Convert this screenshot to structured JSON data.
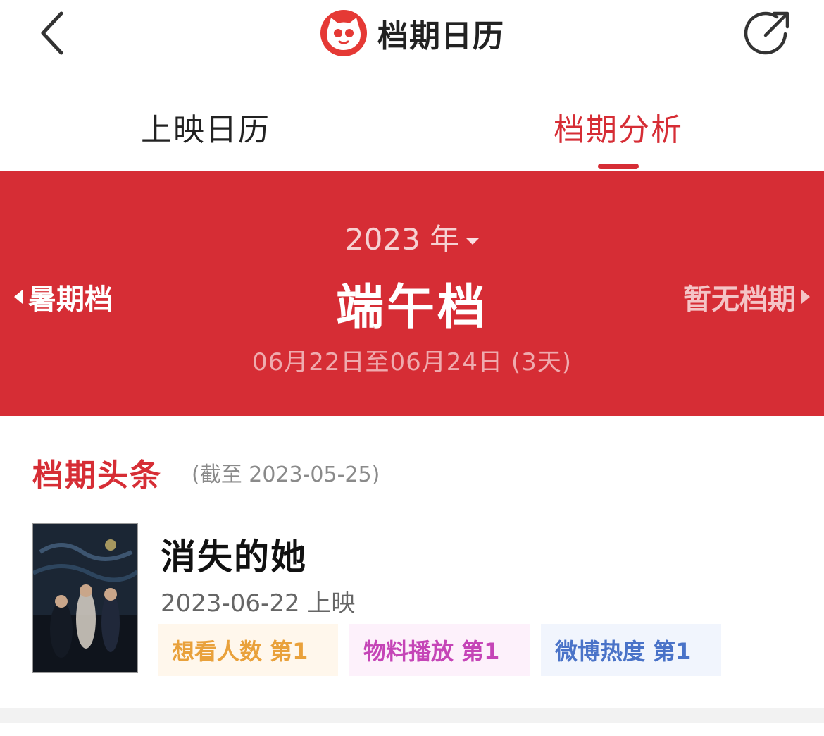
{
  "header": {
    "title": "档期日历",
    "back_icon": "chevron-left-icon",
    "share_icon": "share-icon",
    "logo_icon": "cat-logo-icon"
  },
  "tabs": [
    {
      "label": "上映日历",
      "active": false
    },
    {
      "label": "档期分析",
      "active": true
    }
  ],
  "banner": {
    "year_label": "2023 年",
    "prev_season": "暑期档",
    "current_season": "端午档",
    "next_season": "暂无档期",
    "date_range": "06月22日至06月24日 (3天)"
  },
  "section": {
    "title": "档期头条",
    "note": "(截至 2023-05-25)"
  },
  "movie": {
    "title": "消失的她",
    "release": "2023-06-22 上映",
    "tags": [
      {
        "label": "想看人数 第1",
        "color": "#e9a13b"
      },
      {
        "label": "物料播放 第1",
        "color": "#c545b7"
      },
      {
        "label": "微博热度  第1",
        "color": "#4a73c8"
      }
    ]
  },
  "colors": {
    "accent": "#d62d35"
  }
}
